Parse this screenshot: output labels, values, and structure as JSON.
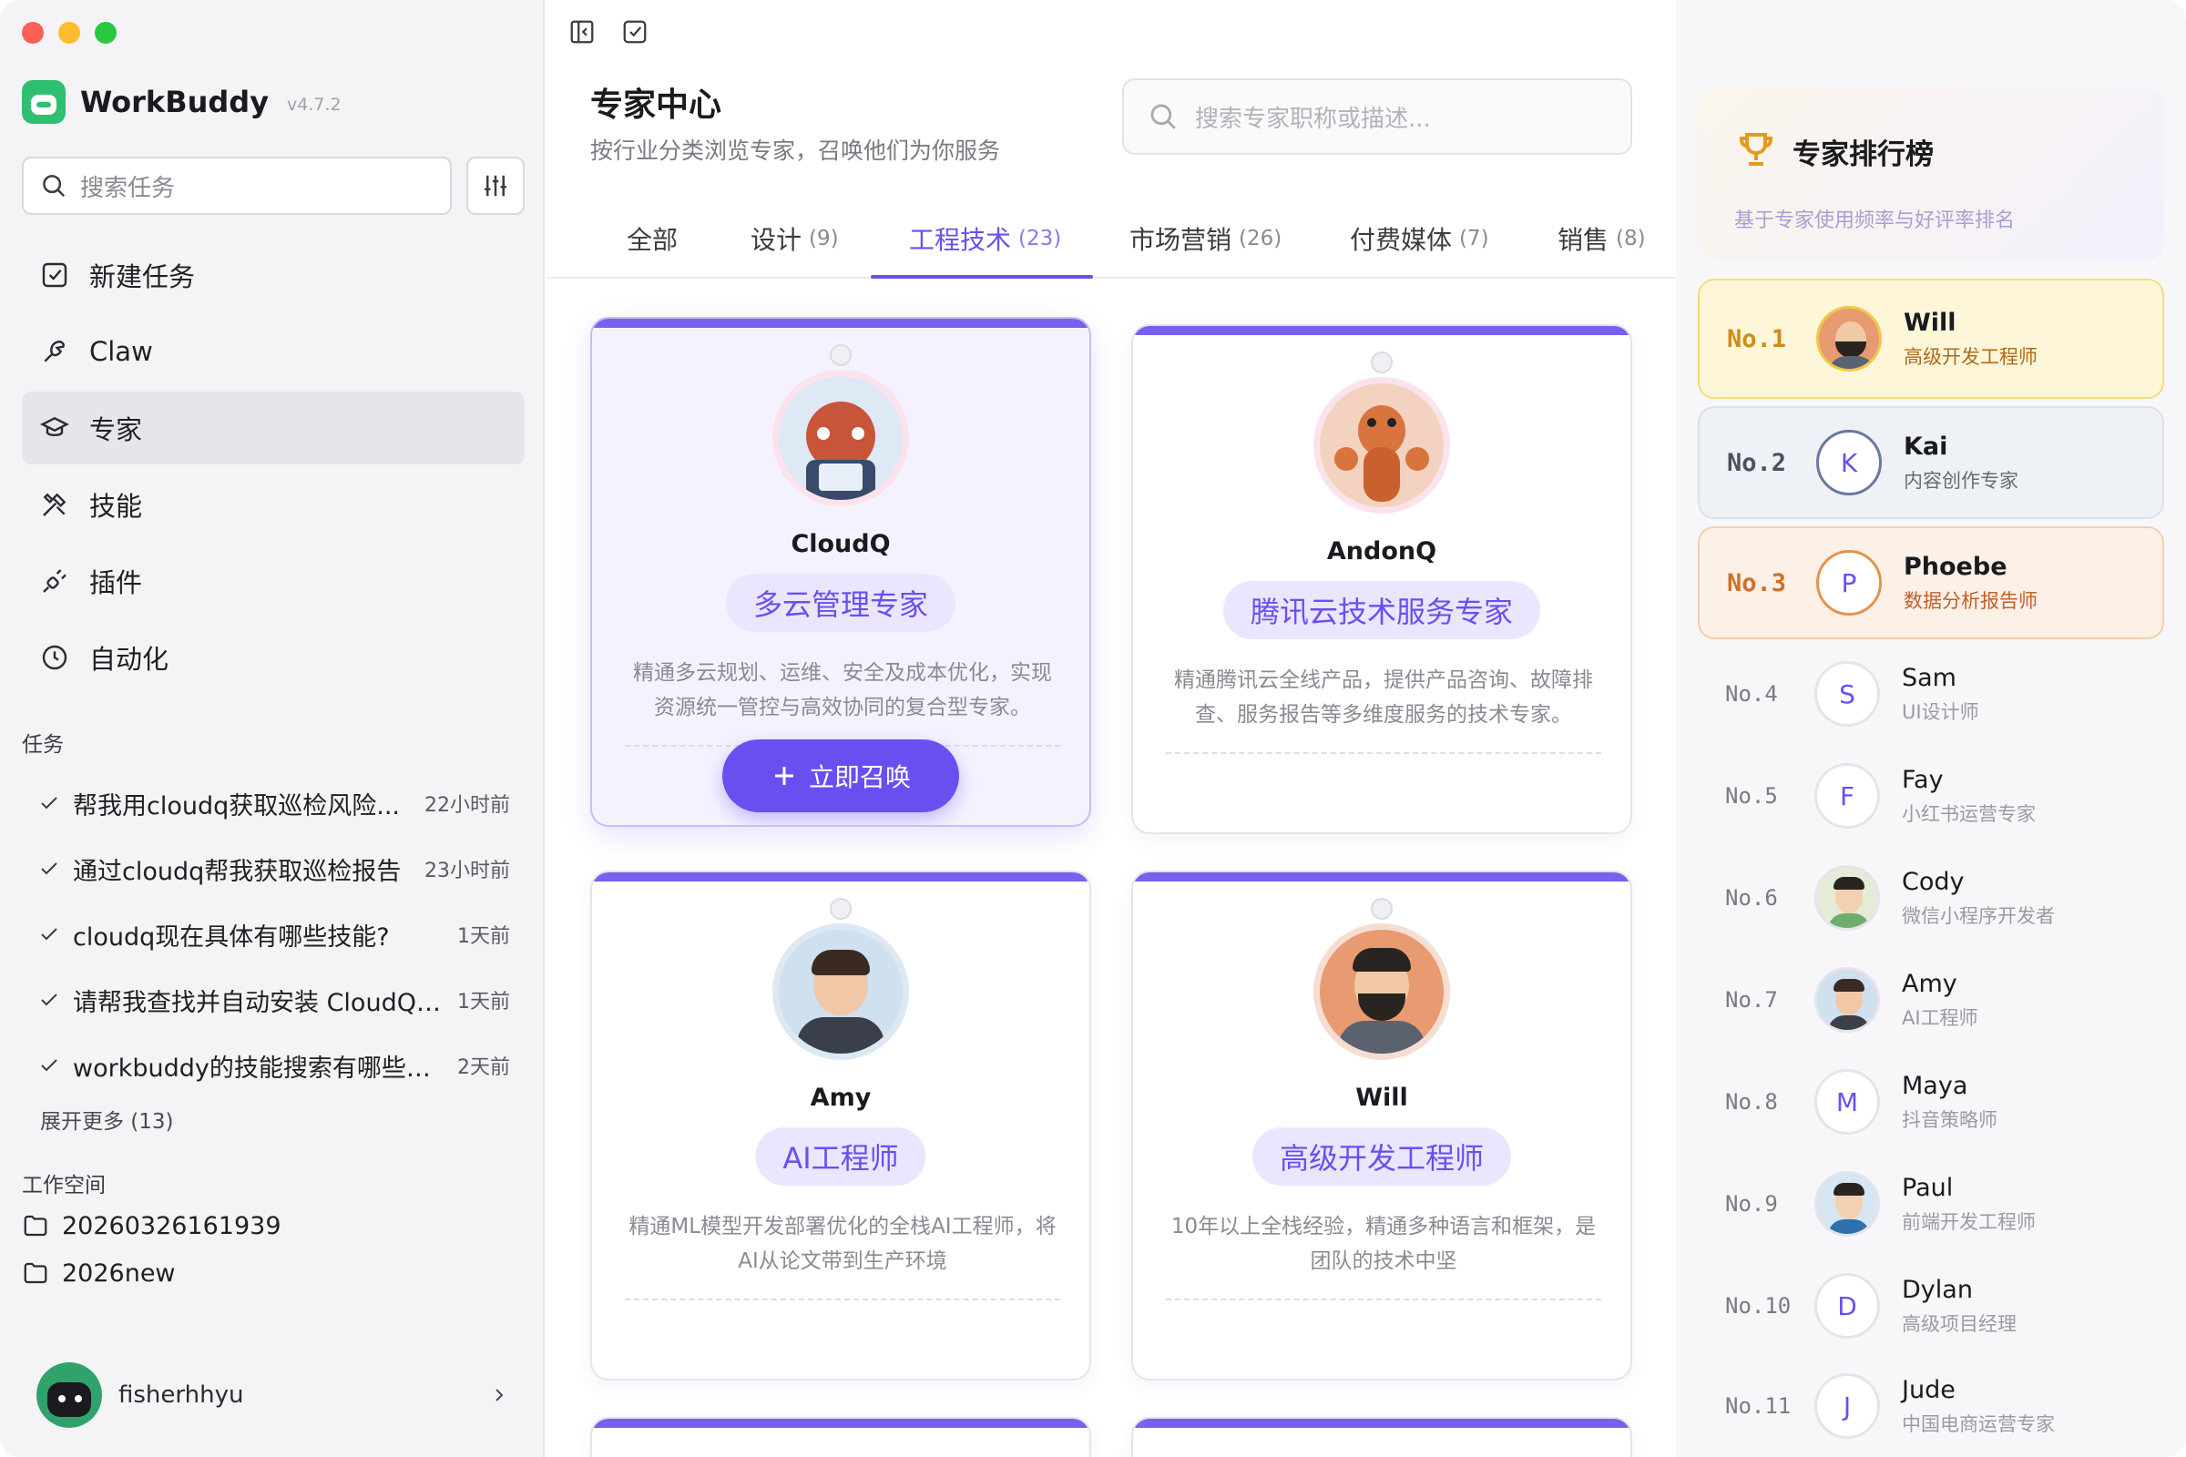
{
  "app": {
    "name": "WorkBuddy",
    "version": "v4.7.2"
  },
  "sidebar": {
    "search_placeholder": "搜索任务",
    "nav": [
      {
        "label": "新建任务",
        "icon": "new-task-icon"
      },
      {
        "label": "Claw",
        "icon": "claw-icon"
      },
      {
        "label": "专家",
        "icon": "graduation-cap-icon",
        "active": true
      },
      {
        "label": "技能",
        "icon": "tools-icon"
      },
      {
        "label": "插件",
        "icon": "plug-icon"
      },
      {
        "label": "自动化",
        "icon": "clock-icon"
      }
    ],
    "tasks_label": "任务",
    "tasks": [
      {
        "title": "帮我用cloudq获取巡检风险...",
        "time": "22小时前"
      },
      {
        "title": "通过cloudq帮我获取巡检报告",
        "time": "23小时前"
      },
      {
        "title": "cloudq现在具体有哪些技能?",
        "time": "1天前"
      },
      {
        "title": "请帮我查找并自动安装 CloudQ ...",
        "time": "1天前"
      },
      {
        "title": "workbuddy的技能搜索有哪些来...",
        "time": "2天前"
      }
    ],
    "expand_more": "展开更多 (13)",
    "workspace_label": "工作空间",
    "workspaces": [
      "20260326161939",
      "2026new"
    ],
    "user": "fisherhhyu"
  },
  "main": {
    "title": "专家中心",
    "subtitle": "按行业分类浏览专家，召唤他们为你服务",
    "search_placeholder": "搜索专家职称或描述...",
    "tabs": [
      {
        "label": "全部",
        "count": ""
      },
      {
        "label": "设计",
        "count": "(9)"
      },
      {
        "label": "工程技术",
        "count": "(23)",
        "active": true
      },
      {
        "label": "市场营销",
        "count": "(26)"
      },
      {
        "label": "付费媒体",
        "count": "(7)"
      },
      {
        "label": "销售",
        "count": "(8)"
      }
    ],
    "summon_label": "立即召唤",
    "cards": [
      {
        "name": "CloudQ",
        "role": "多云管理专家",
        "desc": "精通多云规划、运维、安全及成本优化，实现资源统一管控与高效协同的复合型专家。"
      },
      {
        "name": "AndonQ",
        "role": "腾讯云技术服务专家",
        "desc": "精通腾讯云全线产品，提供产品咨询、故障排查、服务报告等多维度服务的技术专家。"
      },
      {
        "name": "Amy",
        "role": "AI工程师",
        "desc": "精通ML模型开发部署优化的全栈AI工程师，将AI从论文带到生产环境"
      },
      {
        "name": "Will",
        "role": "高级开发工程师",
        "desc": "10年以上全栈经验，精通多种语言和框架，是团队的技术中坚"
      }
    ]
  },
  "ranking": {
    "title": "专家排行榜",
    "subtitle": "基于专家使用频率与好评率排名",
    "items": [
      {
        "rank": "No.1",
        "name": "Will",
        "role": "高级开发工程师",
        "initial": ""
      },
      {
        "rank": "No.2",
        "name": "Kai",
        "role": "内容创作专家",
        "initial": "K"
      },
      {
        "rank": "No.3",
        "name": "Phoebe",
        "role": "数据分析报告师",
        "initial": "P"
      },
      {
        "rank": "No.4",
        "name": "Sam",
        "role": "UI设计师",
        "initial": "S"
      },
      {
        "rank": "No.5",
        "name": "Fay",
        "role": "小红书运营专家",
        "initial": "F"
      },
      {
        "rank": "No.6",
        "name": "Cody",
        "role": "微信小程序开发者",
        "initial": ""
      },
      {
        "rank": "No.7",
        "name": "Amy",
        "role": "AI工程师",
        "initial": ""
      },
      {
        "rank": "No.8",
        "name": "Maya",
        "role": "抖音策略师",
        "initial": "M"
      },
      {
        "rank": "No.9",
        "name": "Paul",
        "role": "前端开发工程师",
        "initial": ""
      },
      {
        "rank": "No.10",
        "name": "Dylan",
        "role": "高级项目经理",
        "initial": "D"
      },
      {
        "rank": "No.11",
        "name": "Jude",
        "role": "中国电商运营专家",
        "initial": "J"
      }
    ]
  }
}
